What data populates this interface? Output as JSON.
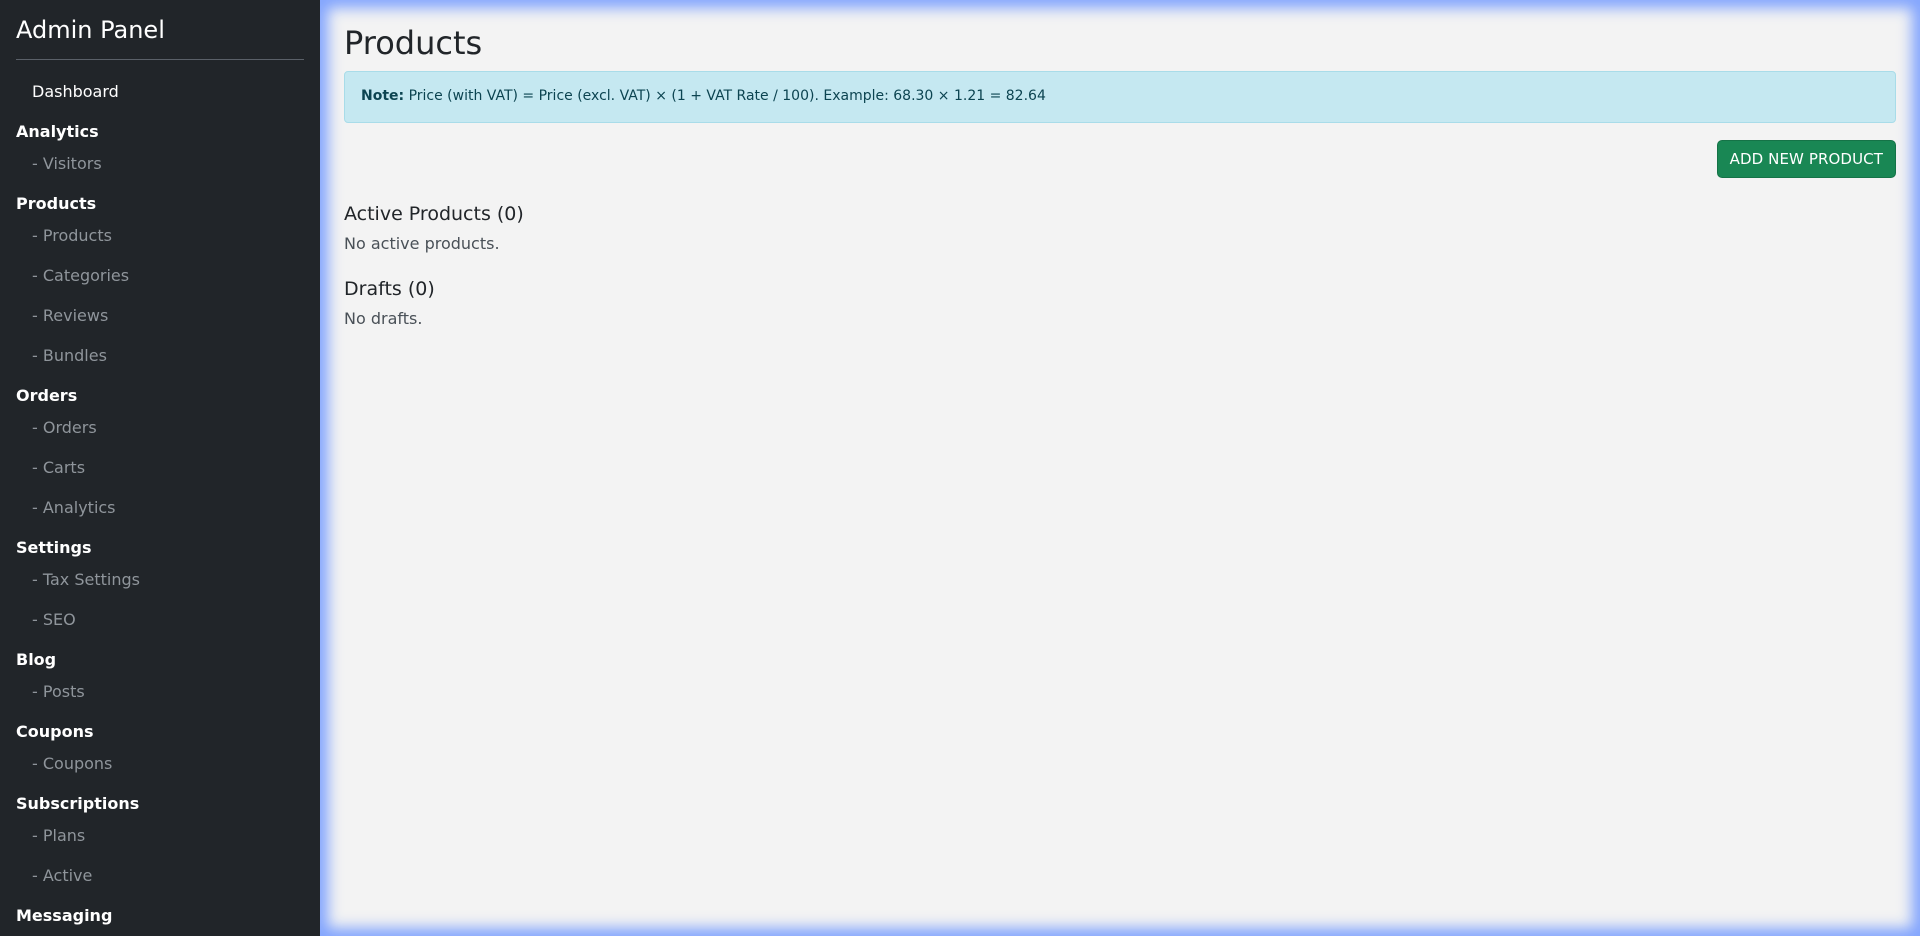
{
  "sidebar": {
    "brand": "Admin Panel",
    "dashboard": "Dashboard",
    "sections": [
      {
        "title": "Analytics",
        "items": [
          "- Visitors"
        ]
      },
      {
        "title": "Products",
        "items": [
          "- Products",
          "- Categories",
          "- Reviews",
          "- Bundles"
        ]
      },
      {
        "title": "Orders",
        "items": [
          "- Orders",
          "- Carts",
          "- Analytics"
        ]
      },
      {
        "title": "Settings",
        "items": [
          "- Tax Settings",
          "- SEO"
        ]
      },
      {
        "title": "Blog",
        "items": [
          "- Posts"
        ]
      },
      {
        "title": "Coupons",
        "items": [
          "- Coupons"
        ]
      },
      {
        "title": "Subscriptions",
        "items": [
          "- Plans",
          "- Active"
        ]
      },
      {
        "title": "Messaging",
        "items": []
      }
    ]
  },
  "main": {
    "title": "Products",
    "note": {
      "label": "Note:",
      "text": " Price (with VAT) = Price (excl. VAT) × (1 + VAT Rate / 100). Example: 68.30 × 1.21 = 82.64"
    },
    "add_button": "ADD NEW PRODUCT",
    "active": {
      "heading": "Active Products (0)",
      "empty": "No active products."
    },
    "drafts": {
      "heading": "Drafts (0)",
      "empty": "No drafts."
    }
  },
  "colors": {
    "sidebar_bg": "#212529",
    "main_bg": "#f3f3f3",
    "note_bg": "#c5e8f1",
    "button_green": "#198754"
  }
}
